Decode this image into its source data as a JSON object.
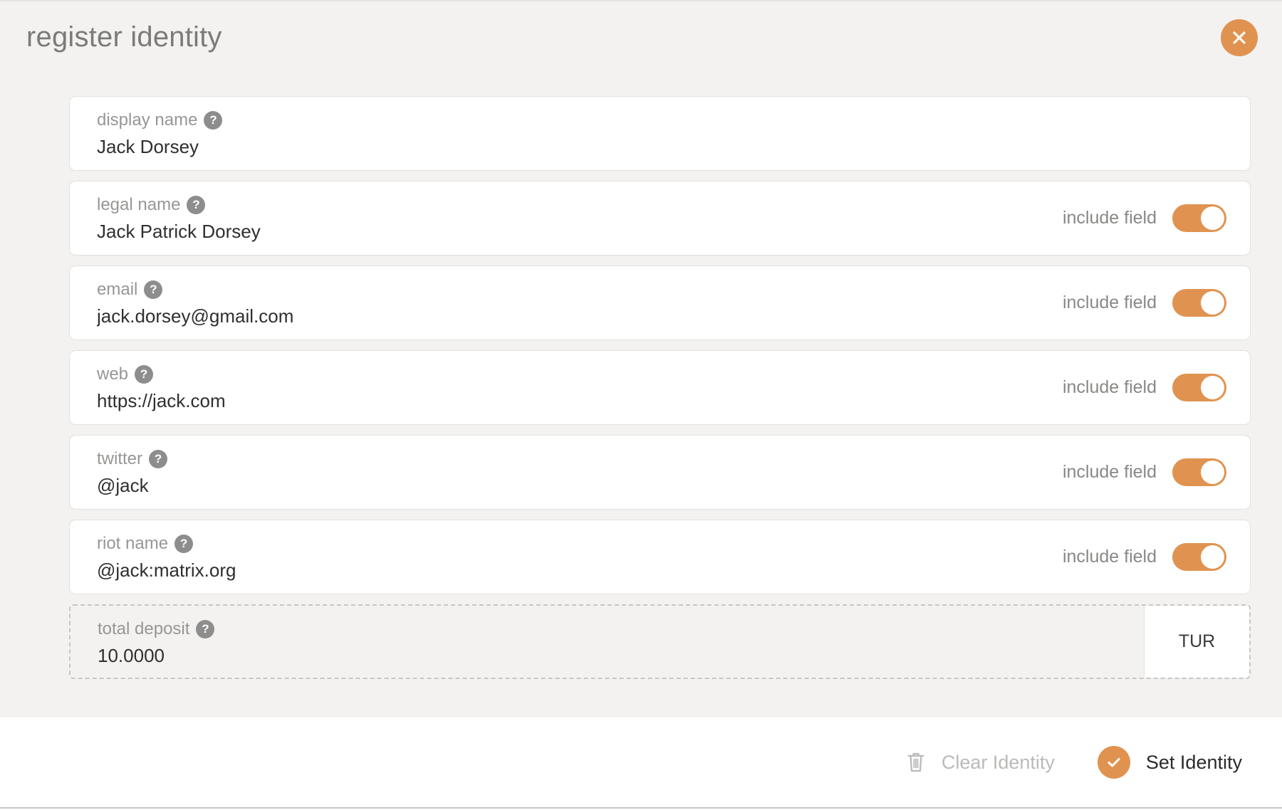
{
  "header": {
    "title": "register identity",
    "close_icon": "close-icon"
  },
  "colors": {
    "accent": "#e09350",
    "body_background": "#f3f2f0",
    "field_background": "#ffffff",
    "label_text": "#989694",
    "value_text": "#2f2f2f",
    "disabled_text": "#bcbab8"
  },
  "fields": [
    {
      "name": "display-name",
      "label": "display name",
      "value": "Jack Dorsey",
      "help_icon": "help-icon",
      "has_toggle": false,
      "include_label": "",
      "toggle_on": false
    },
    {
      "name": "legal-name",
      "label": "legal name",
      "value": "Jack Patrick Dorsey",
      "help_icon": "help-icon",
      "has_toggle": true,
      "include_label": "include field",
      "toggle_on": true
    },
    {
      "name": "email",
      "label": "email",
      "value": "jack.dorsey@gmail.com",
      "help_icon": "help-icon",
      "has_toggle": true,
      "include_label": "include field",
      "toggle_on": true
    },
    {
      "name": "web",
      "label": "web",
      "value": "https://jack.com",
      "help_icon": "help-icon",
      "has_toggle": true,
      "include_label": "include field",
      "toggle_on": true
    },
    {
      "name": "twitter",
      "label": "twitter",
      "value": "@jack",
      "help_icon": "help-icon",
      "has_toggle": true,
      "include_label": "include field",
      "toggle_on": true
    },
    {
      "name": "riot-name",
      "label": "riot name",
      "value": "@jack:matrix.org",
      "help_icon": "help-icon",
      "has_toggle": true,
      "include_label": "include field",
      "toggle_on": true
    }
  ],
  "deposit": {
    "name": "total-deposit",
    "label": "total deposit",
    "value": "10.0000",
    "help_icon": "help-icon",
    "unit": "TUR"
  },
  "footer": {
    "clear": {
      "label": "Clear Identity",
      "icon": "trash-icon",
      "disabled": true
    },
    "set": {
      "label": "Set Identity",
      "icon": "check-circle-icon",
      "disabled": false
    }
  }
}
